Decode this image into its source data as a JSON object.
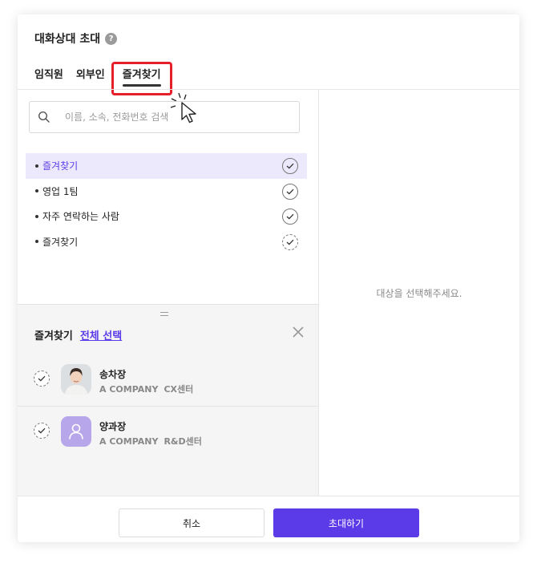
{
  "dialog": {
    "title": "대화상대 초대",
    "help_icon": "question-circle-icon"
  },
  "tabs": [
    {
      "label": "임직원",
      "active": false
    },
    {
      "label": "외부인",
      "active": false
    },
    {
      "label": "즐겨찾기",
      "active": true
    }
  ],
  "search": {
    "placeholder": "이름, 소속, 전화번호 검색",
    "value": "",
    "icon": "search-icon"
  },
  "favorite_groups": [
    {
      "label": "즐겨찾기",
      "selected": true
    },
    {
      "label": "영업 1팀",
      "selected": false
    },
    {
      "label": "자주 연락하는 사람",
      "selected": false
    },
    {
      "label": "즐겨찾기",
      "selected": false
    }
  ],
  "selected_group": {
    "title": "즐겨찾기",
    "select_all_label": "전체 선택",
    "members": [
      {
        "name": "송차장",
        "company": "A COMPANY",
        "department": "CX센터",
        "avatar": "photo-avatar"
      },
      {
        "name": "양과장",
        "company": "A COMPANY",
        "department": "R&D센터",
        "avatar": "default-user-avatar"
      }
    ]
  },
  "right_panel": {
    "empty_message": "대상을 선택해주세요."
  },
  "footer": {
    "cancel_label": "취소",
    "invite_label": "초대하기"
  },
  "colors": {
    "accent": "#5b3be8",
    "selected_row_bg": "#ece9fd",
    "highlight_border": "#e5202a",
    "avatar_default_bg": "#b8a6ea"
  }
}
